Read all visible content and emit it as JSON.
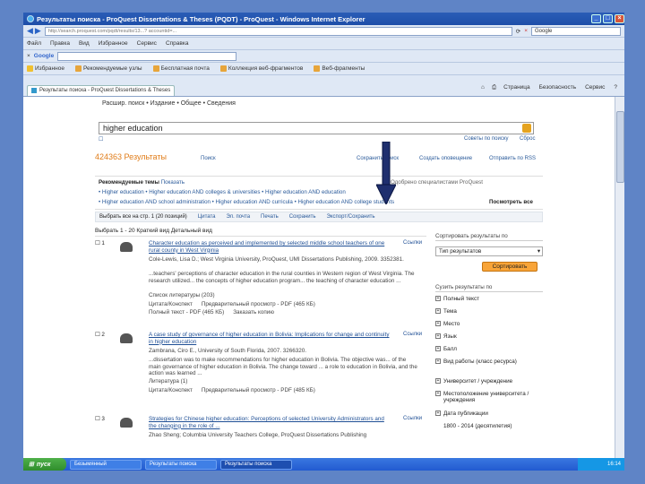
{
  "window": {
    "title": "Результаты поиска - ProQuest Dissertations & Theses (PQDT) - ProQuest - Windows Internet Explorer",
    "address": "http://search.proquest.com/pqdt/results/13...? accountid=...",
    "search_box": "Google"
  },
  "menu": [
    "Файл",
    "Правка",
    "Вид",
    "Избранное",
    "Сервис",
    "Справка"
  ],
  "google_bar": {
    "label": "Google"
  },
  "favorites": [
    "Избранное",
    "Рекомендуемые узлы",
    "Бесплатная почта",
    "Коллекция веб-фрагментов",
    "Веб-фрагменты"
  ],
  "tab": {
    "label": "Результаты поиска - ProQuest Dissertations & Theses"
  },
  "command_bar": [
    "Страница",
    "Безопасность",
    "Сервис"
  ],
  "page": {
    "nav": "Расшир. поиск  •  Издание  •  Общее  •  Сведения",
    "search_value": "higher education",
    "search_tips": "Советы по поиску",
    "search_clear": "Сброс",
    "results_title": "424363 Результаты",
    "results_search_link": "Поиск",
    "actions_right": [
      "Сохранить поиск",
      "Создать оповещение",
      "Отправить по RSS"
    ],
    "recommended_label": "Рекомендуемые темы",
    "recommended_show": "Показать",
    "recommended_line1": "• Higher education  • Higher education AND colleges & universities  • Higher education AND education",
    "recommended_line2": "• Higher education AND school administration  • Higher education AND curricula  • Higher education AND college students",
    "recommended_right": "Посмотреть все",
    "recommended_note": "Одобрено специалистами ProQuest",
    "action_bar": [
      "Выбрать все на стр. 1 (20 позиций)",
      "Цитата",
      "Эл. почта",
      "Печать",
      "Сохранить",
      "Экспорт/Сохранить"
    ],
    "sel_bar": "Выбрать   1 - 20   Краткий вид   Детальный вид",
    "results": [
      {
        "num": "1",
        "title": "Character education as perceived and implemented by selected middle school teachers of one rural county in West Virginia",
        "author": "Cole-Lewis, Lisa D.; West Virginia University, ProQuest, UMI Dissertations Publishing, 2009. 3352381.",
        "snippet": "...teachers' perceptions of character education in the rural counties in Western region of West Virginia. The research utilized... the concepts of higher education program... the teaching of character education ...",
        "refs": "Список литературы (203)",
        "links": [
          "Цитата/Конспект",
          "Предварительный просмотр - PDF (465 КБ)",
          "Полный текст - PDF (465 КБ)",
          "Заказать копию"
        ],
        "full": "Ссылки"
      },
      {
        "num": "2",
        "title": "A case study of governance of higher education in Bolivia: Implications for change and continuity in higher education",
        "author": "Zambrana, Ciro E., University of South Florida, 2007. 3266320.",
        "snippet": "...dissertation was to make recommendations for higher education in Bolivia. The objective was... of the main governance of higher education in Bolivia. The change toward ... a role to education in Bolivia, and the action was learned ...",
        "refs": "Литература (1)",
        "links": [
          "Цитата/Конспект",
          "Предварительный просмотр - PDF (485 КБ)"
        ],
        "full": "Ссылки"
      },
      {
        "num": "3",
        "title": "Strategies for Chinese higher education: Perceptions of selected University Administrators and the changing in the role of ...",
        "author": "Zhao Sheng; Columbia University Teachers College, ProQuest Dissertations Publishing",
        "snippet": "",
        "refs": "",
        "links": [],
        "full": "Ссылки"
      }
    ],
    "sidebar": {
      "sort_label": "Сортировать результаты по",
      "sort_value": "Тип результатов",
      "sort_button": "Сортировать",
      "filter_label": "Сузить результаты по",
      "filters": [
        "Полный текст",
        "Тема",
        "Место",
        "Язык",
        "Балл",
        "Вид работы (класс ресурса)",
        "Университет / учреждение",
        "Местоположение университета / учреждения",
        "Дата публикации"
      ],
      "date_range": "1800 - 2014 (десятилетия)"
    }
  },
  "taskbar": {
    "start": "пуск",
    "tasks": [
      "Безымянный",
      "Результаты поиска",
      "Результаты поиска"
    ],
    "clock": "16:14"
  }
}
